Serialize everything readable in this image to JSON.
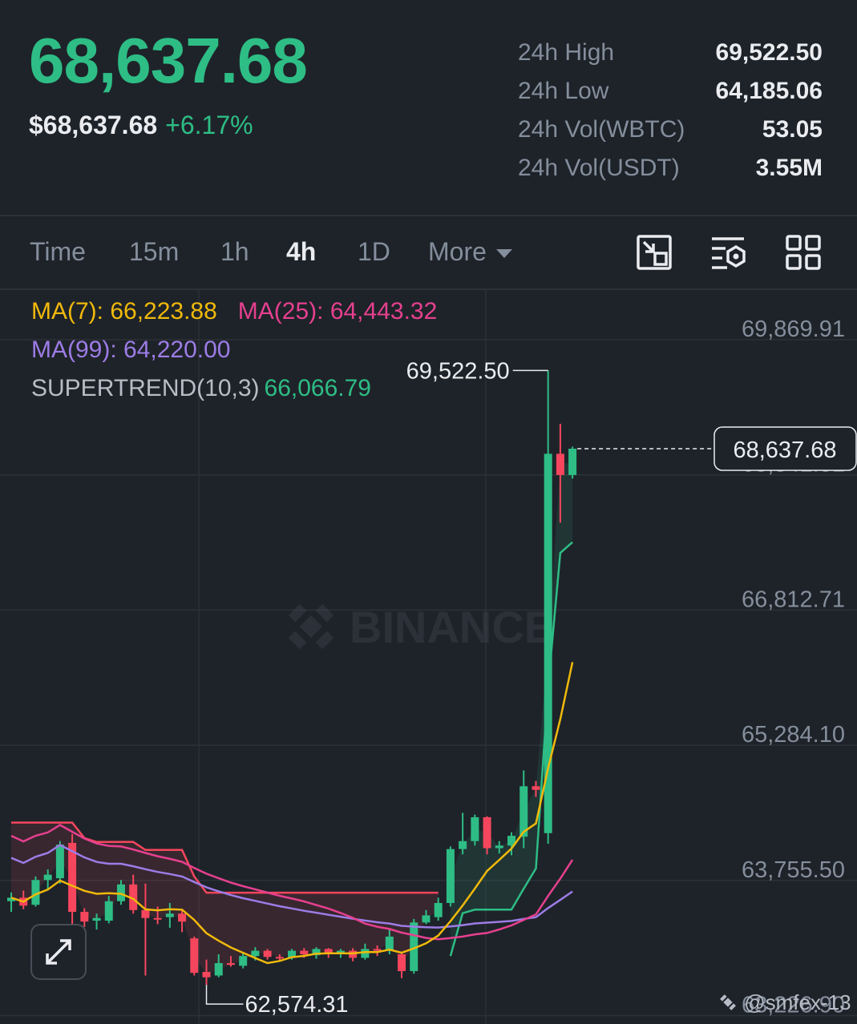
{
  "header": {
    "last_price": "68,637.68",
    "usd_price": "$68,637.68",
    "change_pct": "+6.17%",
    "stats": [
      {
        "label": "24h High",
        "value": "69,522.50"
      },
      {
        "label": "24h Low",
        "value": "64,185.06"
      },
      {
        "label": "24h Vol(WBTC)",
        "value": "53.05"
      },
      {
        "label": "24h Vol(USDT)",
        "value": "3.55M"
      }
    ]
  },
  "toolbar": {
    "tabs": [
      "Time",
      "15m",
      "1h",
      "4h",
      "1D",
      "More"
    ],
    "active_tab": "4h",
    "icons": [
      "chart-switch-icon",
      "indicator-settings-icon",
      "grid-layout-icon"
    ]
  },
  "indicators": {
    "ma7": "MA(7): 66,223.88",
    "ma25": "MA(25): 64,443.32",
    "ma99": "MA(99): 64,220.00",
    "supertrend_label": "SUPERTREND(10,3)",
    "supertrend_value": "66,066.79"
  },
  "watermark_logo": "BINANCE",
  "footer_handle": "@smfex-13",
  "colors": {
    "up": "#2ebd85",
    "down": "#f6465d",
    "ma7": "#f0b90b",
    "ma25": "#e6408f",
    "ma99": "#9d7ce6",
    "background": "#1e2329"
  },
  "chart_data": {
    "type": "candlestick",
    "interval": "4h",
    "y_ticks": [
      69869.91,
      68341.31,
      66812.71,
      65284.1,
      63755.5,
      62226.9
    ],
    "y_tick_labels": [
      "69,869.91",
      "68,341.31",
      "66,812.71",
      "65,284.10",
      "63,755.50",
      "63,226.90"
    ],
    "ylim": [
      62200,
      70400
    ],
    "current_price": 68637.68,
    "current_price_label": "68,637.68",
    "high_marker": {
      "value": 69522.5,
      "label": "69,522.50",
      "index": 44
    },
    "low_marker": {
      "value": 62574.31,
      "label": "62,574.31",
      "index": 16
    },
    "candles": [
      {
        "o": 63520,
        "h": 63620,
        "l": 63400,
        "c": 63560
      },
      {
        "o": 63560,
        "h": 63640,
        "l": 63430,
        "c": 63470
      },
      {
        "o": 63480,
        "h": 63800,
        "l": 63460,
        "c": 63760
      },
      {
        "o": 63760,
        "h": 63880,
        "l": 63660,
        "c": 63820
      },
      {
        "o": 63780,
        "h": 64200,
        "l": 63720,
        "c": 64160
      },
      {
        "o": 64180,
        "h": 64280,
        "l": 63260,
        "c": 63400
      },
      {
        "o": 63400,
        "h": 63440,
        "l": 63230,
        "c": 63290
      },
      {
        "o": 63300,
        "h": 63380,
        "l": 63200,
        "c": 63330
      },
      {
        "o": 63300,
        "h": 63580,
        "l": 63270,
        "c": 63520
      },
      {
        "o": 63520,
        "h": 63760,
        "l": 63480,
        "c": 63710
      },
      {
        "o": 63710,
        "h": 63820,
        "l": 63380,
        "c": 63420
      },
      {
        "o": 63420,
        "h": 63720,
        "l": 62680,
        "c": 63330
      },
      {
        "o": 63330,
        "h": 63460,
        "l": 63260,
        "c": 63320
      },
      {
        "o": 63340,
        "h": 63500,
        "l": 63220,
        "c": 63380
      },
      {
        "o": 63380,
        "h": 63430,
        "l": 63170,
        "c": 63290
      },
      {
        "o": 63100,
        "h": 63120,
        "l": 62680,
        "c": 62710
      },
      {
        "o": 62720,
        "h": 62860,
        "l": 62574,
        "c": 62660
      },
      {
        "o": 62680,
        "h": 62920,
        "l": 62660,
        "c": 62820
      },
      {
        "o": 62820,
        "h": 62900,
        "l": 62780,
        "c": 62800
      },
      {
        "o": 62790,
        "h": 62940,
        "l": 62760,
        "c": 62900
      },
      {
        "o": 62900,
        "h": 63000,
        "l": 62850,
        "c": 62960
      },
      {
        "o": 62960,
        "h": 62980,
        "l": 62860,
        "c": 62890
      },
      {
        "o": 62890,
        "h": 62920,
        "l": 62840,
        "c": 62880
      },
      {
        "o": 62880,
        "h": 62980,
        "l": 62860,
        "c": 62960
      },
      {
        "o": 62960,
        "h": 62990,
        "l": 62880,
        "c": 62920
      },
      {
        "o": 62910,
        "h": 63000,
        "l": 62870,
        "c": 62980
      },
      {
        "o": 62980,
        "h": 62990,
        "l": 62880,
        "c": 62930
      },
      {
        "o": 62940,
        "h": 62980,
        "l": 62880,
        "c": 62960
      },
      {
        "o": 62960,
        "h": 62990,
        "l": 62840,
        "c": 62880
      },
      {
        "o": 62880,
        "h": 63040,
        "l": 62860,
        "c": 62980
      },
      {
        "o": 62980,
        "h": 63020,
        "l": 62900,
        "c": 62960
      },
      {
        "o": 62960,
        "h": 63200,
        "l": 62920,
        "c": 63120
      },
      {
        "o": 62920,
        "h": 62940,
        "l": 62650,
        "c": 62730
      },
      {
        "o": 62730,
        "h": 63320,
        "l": 62700,
        "c": 63280
      },
      {
        "o": 63280,
        "h": 63420,
        "l": 63260,
        "c": 63360
      },
      {
        "o": 63340,
        "h": 63560,
        "l": 63300,
        "c": 63500
      },
      {
        "o": 63500,
        "h": 64140,
        "l": 63460,
        "c": 64110
      },
      {
        "o": 64110,
        "h": 64520,
        "l": 64050,
        "c": 64200
      },
      {
        "o": 64200,
        "h": 64500,
        "l": 64150,
        "c": 64470
      },
      {
        "o": 64470,
        "h": 64480,
        "l": 64050,
        "c": 64120
      },
      {
        "o": 64120,
        "h": 64200,
        "l": 64060,
        "c": 64150
      },
      {
        "o": 64150,
        "h": 64300,
        "l": 64040,
        "c": 64260
      },
      {
        "o": 64250,
        "h": 65000,
        "l": 64120,
        "c": 64820
      },
      {
        "o": 64820,
        "h": 64880,
        "l": 64700,
        "c": 64780
      },
      {
        "o": 64290,
        "h": 69522.5,
        "l": 64170,
        "c": 68580
      },
      {
        "o": 68580,
        "h": 68920,
        "l": 67800,
        "c": 68340
      },
      {
        "o": 68340,
        "h": 68660,
        "l": 68300,
        "c": 68637.68
      }
    ]
  }
}
